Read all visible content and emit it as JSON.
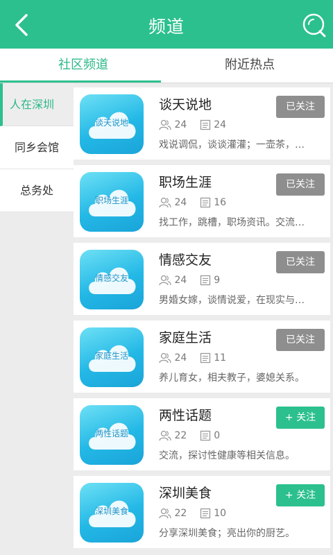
{
  "header": {
    "title": "频道"
  },
  "tabs": [
    {
      "label": "社区频道",
      "active": true
    },
    {
      "label": "附近热点",
      "active": false
    }
  ],
  "sidebar": {
    "items": [
      {
        "label": "人在深圳",
        "active": true
      },
      {
        "label": "同乡会馆",
        "active": false
      },
      {
        "label": "总务处",
        "active": false
      }
    ]
  },
  "channels": [
    {
      "name": "谈天说地",
      "thumb_label": "谈天说地",
      "members": "24",
      "posts": "24",
      "desc": "戏说调侃，谈谈灌灌；一壶茶，…",
      "button": "已关注",
      "followed": true
    },
    {
      "name": "职场生涯",
      "thumb_label": "职场生涯",
      "members": "24",
      "posts": "16",
      "desc": "找工作，跳槽，职场资讯。交流…",
      "button": "已关注",
      "followed": true
    },
    {
      "name": "情感交友",
      "thumb_label": "情感交友",
      "members": "24",
      "posts": "9",
      "desc": "男婚女嫁，谈情说爱，在现实与…",
      "button": "已关注",
      "followed": true
    },
    {
      "name": "家庭生活",
      "thumb_label": "家庭生活",
      "members": "24",
      "posts": "11",
      "desc": "养儿育女，相夫教子，婆媳关系。",
      "button": "已关注",
      "followed": true
    },
    {
      "name": "两性话题",
      "thumb_label": "两性话题",
      "members": "22",
      "posts": "0",
      "desc": "交流，探讨性健康等相关信息。",
      "button": "+ 关注",
      "followed": false
    },
    {
      "name": "深圳美食",
      "thumb_label": "深圳美食",
      "members": "22",
      "posts": "10",
      "desc": "分享深圳美食；亮出你的厨艺。",
      "button": "+ 关注",
      "followed": false
    }
  ],
  "colors": {
    "primary": "#2cc08e",
    "followed_button": "#8e8e8e",
    "thumb_blue": "#23b8e6"
  }
}
